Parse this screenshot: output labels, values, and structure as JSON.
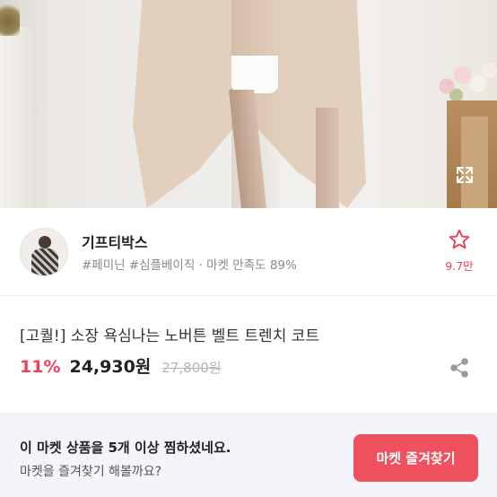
{
  "photo": {
    "expand_icon": "expand-arrows-icon"
  },
  "seller": {
    "name": "기프티박스",
    "tags": "#페미닌 #심플베이직 · 마켓 만족도 89%",
    "favorite_icon": "star-outline-icon",
    "favorite_count": "9.7만",
    "accent_color": "#f0405a"
  },
  "product": {
    "title": "[고퀄!] 소장 욕심나는 노버튼 벨트 트렌치 코트",
    "discount": "11%",
    "price": "24,930원",
    "original_price": "27,800원",
    "share_icon": "share-icon"
  },
  "banner": {
    "title": "이 마켓 상품을 5개 이상 찜하셨네요.",
    "subtitle": "마켓을 즐겨찾기 해볼까요?",
    "button_label": "마켓 즐겨찾기",
    "button_color": "#f0515f",
    "background": "#f3f5fa"
  }
}
